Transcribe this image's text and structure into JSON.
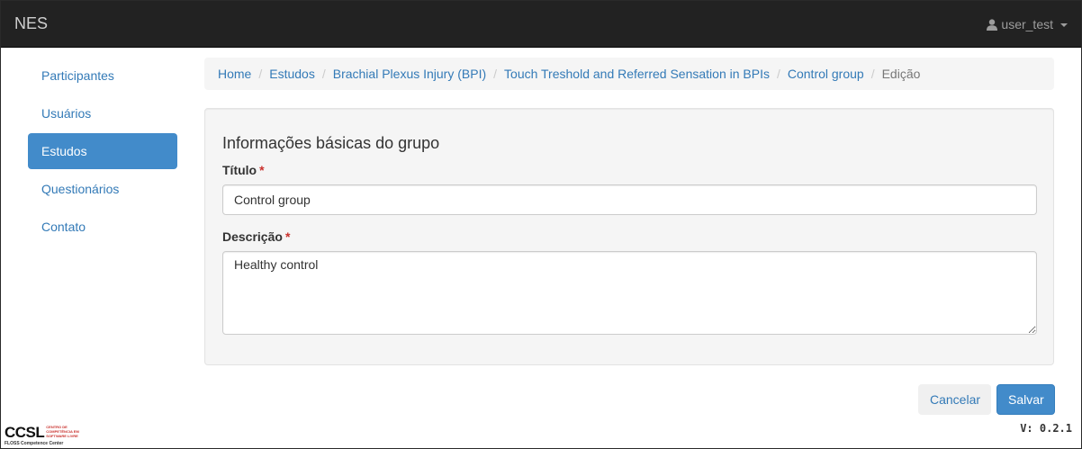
{
  "navbar": {
    "brand": "NES",
    "user": "user_test",
    "icons": {
      "user": "user-icon",
      "caret": "caret-down-icon"
    }
  },
  "sidebar": {
    "items": [
      {
        "label": "Participantes",
        "active": false
      },
      {
        "label": "Usuários",
        "active": false
      },
      {
        "label": "Estudos",
        "active": true
      },
      {
        "label": "Questionários",
        "active": false
      },
      {
        "label": "Contato",
        "active": false
      }
    ]
  },
  "breadcrumb": {
    "items": [
      "Home",
      "Estudos",
      "Brachial Plexus Injury (BPI)",
      "Touch Treshold and Referred Sensation in BPIs",
      "Control group"
    ],
    "current": "Edição",
    "separator": "/"
  },
  "form": {
    "title": "Informações básicas do grupo",
    "required_mark": "*",
    "title_label": "Título",
    "title_value": "Control group",
    "description_label": "Descrição",
    "description_value": "Healthy control"
  },
  "actions": {
    "cancel": "Cancelar",
    "save": "Salvar"
  },
  "footer": {
    "logo_main": "CCSL",
    "logo_side_1": "Centro de",
    "logo_side_2": "Competência em",
    "logo_side_3": "Software Livre",
    "logo_sub": "FLOSS Competence Center",
    "version": "V: 0.2.1"
  },
  "colors": {
    "navbar_bg": "#222222",
    "link": "#337ab7",
    "primary": "#428bca",
    "required": "#c9302c",
    "panel_bg": "#f5f5f5"
  }
}
